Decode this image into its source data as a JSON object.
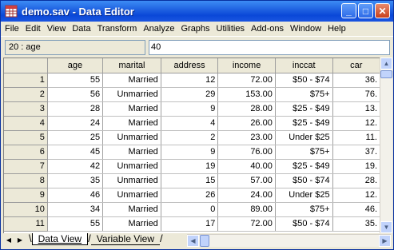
{
  "window": {
    "title": "demo.sav - Data Editor",
    "minimize": "_",
    "maximize": "□",
    "close": "✕"
  },
  "menu": [
    "File",
    "Edit",
    "View",
    "Data",
    "Transform",
    "Analyze",
    "Graphs",
    "Utilities",
    "Add-ons",
    "Window",
    "Help"
  ],
  "cell_ref": "20 : age",
  "cell_value": "40",
  "columns": [
    "age",
    "marital",
    "address",
    "income",
    "inccat",
    "car"
  ],
  "rows": [
    {
      "n": "1",
      "age": "55",
      "marital": "Married",
      "address": "12",
      "income": "72.00",
      "inccat": "$50 - $74",
      "car": "36."
    },
    {
      "n": "2",
      "age": "56",
      "marital": "Unmarried",
      "address": "29",
      "income": "153.00",
      "inccat": "$75+",
      "car": "76."
    },
    {
      "n": "3",
      "age": "28",
      "marital": "Married",
      "address": "9",
      "income": "28.00",
      "inccat": "$25 - $49",
      "car": "13."
    },
    {
      "n": "4",
      "age": "24",
      "marital": "Married",
      "address": "4",
      "income": "26.00",
      "inccat": "$25 - $49",
      "car": "12."
    },
    {
      "n": "5",
      "age": "25",
      "marital": "Unmarried",
      "address": "2",
      "income": "23.00",
      "inccat": "Under $25",
      "car": "11."
    },
    {
      "n": "6",
      "age": "45",
      "marital": "Married",
      "address": "9",
      "income": "76.00",
      "inccat": "$75+",
      "car": "37."
    },
    {
      "n": "7",
      "age": "42",
      "marital": "Unmarried",
      "address": "19",
      "income": "40.00",
      "inccat": "$25 - $49",
      "car": "19."
    },
    {
      "n": "8",
      "age": "35",
      "marital": "Unmarried",
      "address": "15",
      "income": "57.00",
      "inccat": "$50 - $74",
      "car": "28."
    },
    {
      "n": "9",
      "age": "46",
      "marital": "Unmarried",
      "address": "26",
      "income": "24.00",
      "inccat": "Under $25",
      "car": "12."
    },
    {
      "n": "10",
      "age": "34",
      "marital": "Married",
      "address": "0",
      "income": "89.00",
      "inccat": "$75+",
      "car": "46."
    },
    {
      "n": "11",
      "age": "55",
      "marital": "Married",
      "address": "17",
      "income": "72.00",
      "inccat": "$50 - $74",
      "car": "35."
    }
  ],
  "tabs": {
    "data_view": "Data View",
    "variable_view": "Variable View"
  },
  "colors": {
    "title_bar": "#0a48d8",
    "menu_bg": "#ece9d8",
    "header_bg": "#ece9d8"
  },
  "icons": {
    "app": "spreadsheet-icon"
  }
}
